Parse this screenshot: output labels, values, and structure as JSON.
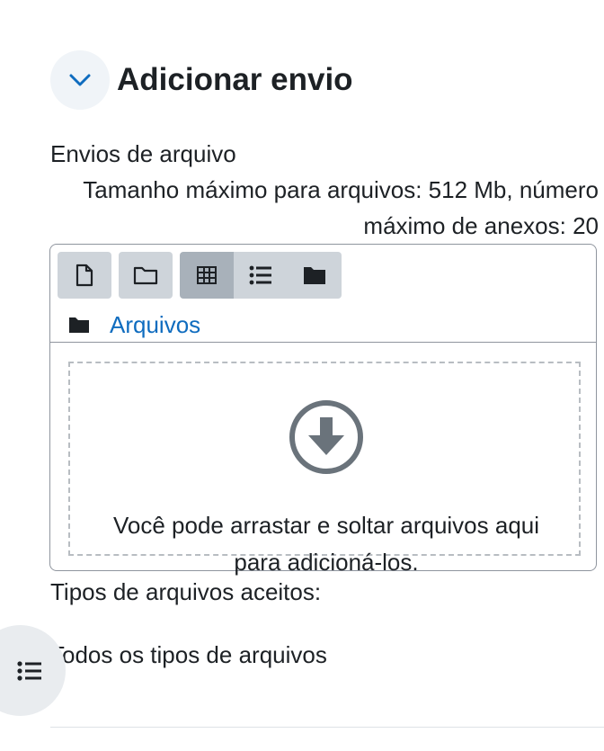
{
  "section": {
    "title": "Adicionar envio",
    "toggle_icon": "chevron-down-icon"
  },
  "file_submissions": {
    "label": "Envios de arquivo",
    "max_info_line1": "Tamanho máximo para arquivos: 512 Mb, número",
    "max_info_line2": "máximo de anexos: 20"
  },
  "filemanager": {
    "toolbar": [
      {
        "icon": "add-file-icon"
      },
      {
        "icon": "create-folder-icon"
      },
      {
        "icon": "grid-view-icon",
        "active": true
      },
      {
        "icon": "list-view-icon"
      },
      {
        "icon": "folder-tree-view-icon"
      }
    ],
    "path_icon": "folder-icon",
    "path_label": "Arquivos",
    "dropzone_icon": "download-arrow-icon",
    "dropzone_text_line1": "Você pode arrastar e soltar arquivos aqui",
    "dropzone_text_line2": "para adicioná-los."
  },
  "accepted_types": {
    "label": "Tipos de arquivos aceitos:",
    "value": "Todos os tipos de arquivos"
  },
  "drawer": {
    "icon": "list-icon"
  },
  "colors": {
    "link": "#0f6cbf",
    "toolbar_button": "#ced4da",
    "toolbar_button_active": "#a8b1ba",
    "toggle_bg": "#f0f4f8",
    "drawer_bg": "#e9ecef"
  }
}
